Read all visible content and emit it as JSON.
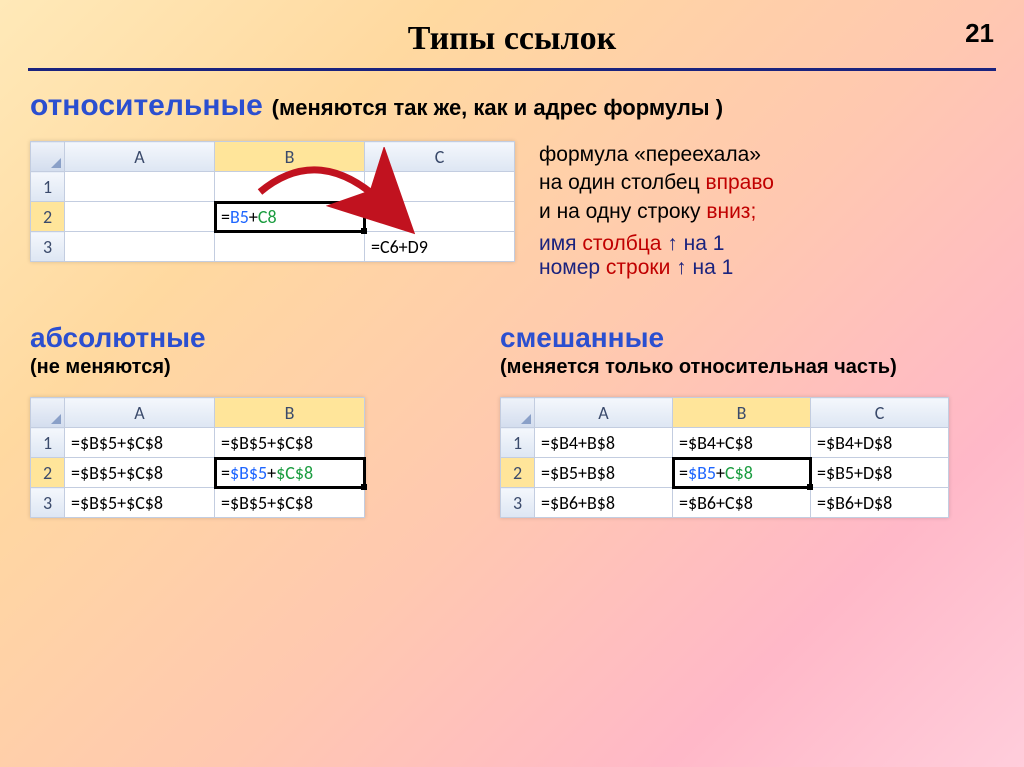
{
  "page_number": "21",
  "title": "Типы ссылок",
  "section1": {
    "heading": "относительные",
    "note": "(меняются так же, как и адрес формулы )",
    "explain_l1": "формула «переехала»",
    "explain_l2_a": "на один столбец ",
    "explain_l2_b": "вправо",
    "explain_l3_a": "и на одну строку ",
    "explain_l3_b": "вниз;",
    "hint_l1_a": "имя ",
    "hint_l1_b": "столбца",
    "hint_l1_c": " ↑ на 1",
    "hint_l2_a": "номер ",
    "hint_l2_b": "строки",
    "hint_l2_c": " ↑ на 1"
  },
  "table1": {
    "cols": [
      "A",
      "B",
      "C"
    ],
    "rows": [
      "1",
      "2",
      "3"
    ],
    "b2_eq": "=",
    "b2_ref1": "B5",
    "b2_plus": "+",
    "b2_ref2": "C8",
    "c3": "=C6+D9"
  },
  "section2a": {
    "heading": "абсолютные",
    "note": "(не меняются)"
  },
  "section2b": {
    "heading": "смешанные",
    "note": "(меняется только относительная часть)"
  },
  "table2": {
    "cols": [
      "A",
      "B"
    ],
    "rows": [
      "1",
      "2",
      "3"
    ],
    "a1": "=$B$5+$C$8",
    "b1": "=$B$5+$C$8",
    "a2": "=$B$5+$C$8",
    "b2_eq": "=",
    "b2_r1": "$B$5",
    "b2_plus": "+",
    "b2_r2": "$C$8",
    "a3": "=$B$5+$C$8",
    "b3": "=$B$5+$C$8"
  },
  "table3": {
    "cols": [
      "A",
      "B",
      "C"
    ],
    "rows": [
      "1",
      "2",
      "3"
    ],
    "a1": "=$B4+B$8",
    "b1": "=$B4+C$8",
    "c1": "=$B4+D$8",
    "a2": "=$B5+B$8",
    "b2_eq": "=",
    "b2_r1": "$B5",
    "b2_plus": "+",
    "b2_r2": "C$8",
    "c2": "=$B5+D$8",
    "a3": "=$B6+B$8",
    "b3": "=$B6+C$8",
    "c3": "=$B6+D$8"
  }
}
